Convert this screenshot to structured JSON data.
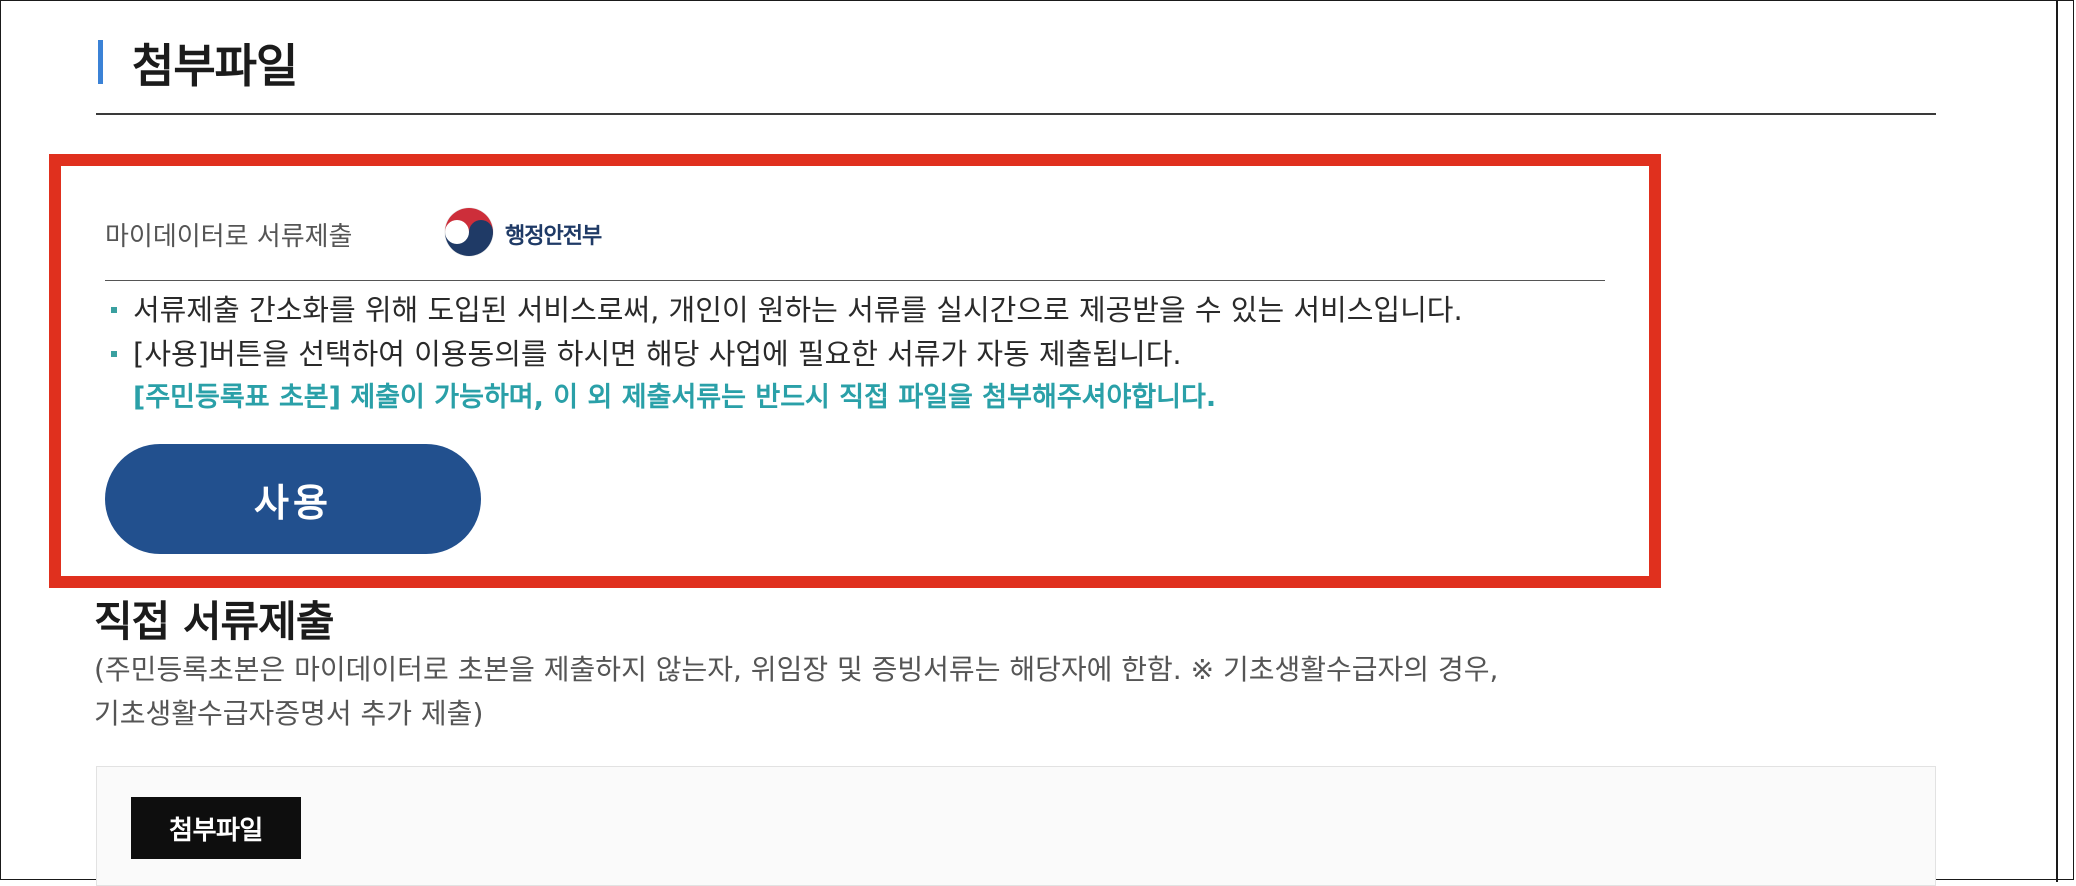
{
  "section": {
    "title": "첨부파일"
  },
  "mydata": {
    "title": "마이데이터로 서류제출",
    "org_name": "행정안전부",
    "bullets": [
      "서류제출 간소화를 위해 도입된 서비스로써, 개인이 원하는 서류를 실시간으로 제공받을 수 있는 서비스입니다.",
      "[사용]버튼을 선택하여 이용동의를 하시면 해당 사업에 필요한 서류가 자동 제출됩니다."
    ],
    "notice": "[주민등록표 초본] 제출이 가능하며, 이 외 제출서류는 반드시 직접 파일을 첨부해주셔야합니다.",
    "use_button": "사용"
  },
  "direct": {
    "title": "직접 서류제출",
    "description_line1": "(주민등록초본은 마이데이터로 초본을 제출하지 않는자, 위임장 및 증빙서류는 해당자에 한함. ※ 기초생활수급자의 경우,",
    "description_line2": "기초생활수급자증명서 추가 제출)"
  },
  "attachment": {
    "badge": "첨부파일"
  },
  "colors": {
    "accent": "#3b82d6",
    "highlight_border": "#e0301e",
    "notice_text": "#2aa0a8",
    "button": "#22508e"
  }
}
